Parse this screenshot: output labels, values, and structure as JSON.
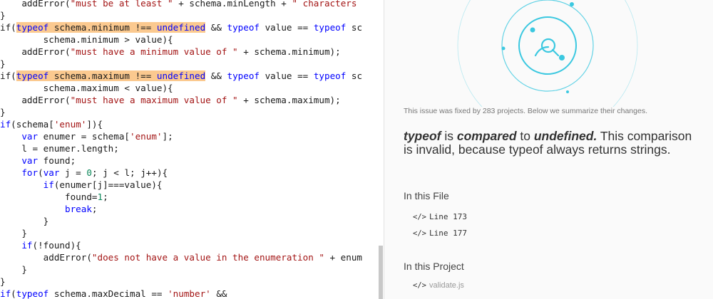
{
  "code": {
    "lines": [
      "    addError(\"must be at least \" + schema.minLength + \" characters",
      "}",
      "if(typeof schema.minimum !== undefined && typeof value == typeof sc",
      "        schema.minimum > value){",
      "    addError(\"must have a minimum value of \" + schema.minimum);",
      "}",
      "if(typeof schema.maximum !== undefined && typeof value == typeof sc",
      "        schema.maximum < value){",
      "    addError(\"must have a maximum value of \" + schema.maximum);",
      "}",
      "if(schema['enum']){",
      "    var enumer = schema['enum'];",
      "    l = enumer.length;",
      "    var found;",
      "    for(var j = 0; j < l; j++){",
      "        if(enumer[j]===value){",
      "            found=1;",
      "            break;",
      "        }",
      "    }",
      "    if(!found){",
      "        addError(\"does not have a value in the enumeration \" + enum",
      "    }",
      "}",
      "if(typeof schema.maxDecimal == 'number' &&"
    ]
  },
  "info": {
    "summary": "This issue was fixed by 283 projects. Below we summarize their changes.",
    "title": {
      "kw1": "typeof",
      "t1": " is ",
      "kw2": "compared",
      "t2": " to ",
      "kw3": "undefined.",
      "t3": " This comparison is invalid, because typeof always returns strings."
    },
    "in_this_file_heading": "In this File",
    "file_links": [
      {
        "icon": "</>",
        "label": "Line 173"
      },
      {
        "icon": "</>",
        "label": "Line 177"
      }
    ],
    "in_this_project_heading": "In this Project",
    "project_links": [
      {
        "icon": "</>",
        "label": "validate.js"
      }
    ]
  },
  "colors": {
    "highlight": "#fbc98f",
    "keyword": "#0000ff",
    "string": "#a31515",
    "number": "#098658",
    "illustration": "#3bc8e0"
  }
}
